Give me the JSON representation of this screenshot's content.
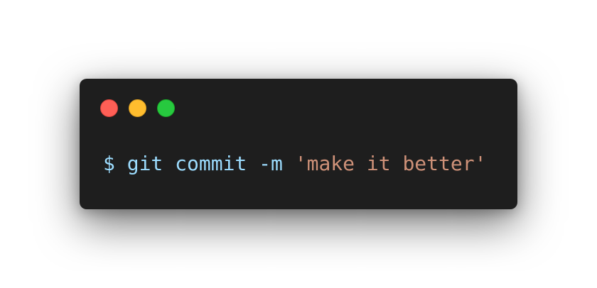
{
  "window": {
    "controls": [
      {
        "name": "close",
        "color": "#ff5f56"
      },
      {
        "name": "minimize",
        "color": "#ffbd2e"
      },
      {
        "name": "maximize",
        "color": "#27c93f"
      }
    ],
    "background": "#1e1e1e"
  },
  "terminal": {
    "prompt": "$",
    "command": "git commit -m",
    "argument": "'make it better'",
    "colors": {
      "command": "#9cdcfe",
      "string": "#ce9178"
    }
  }
}
